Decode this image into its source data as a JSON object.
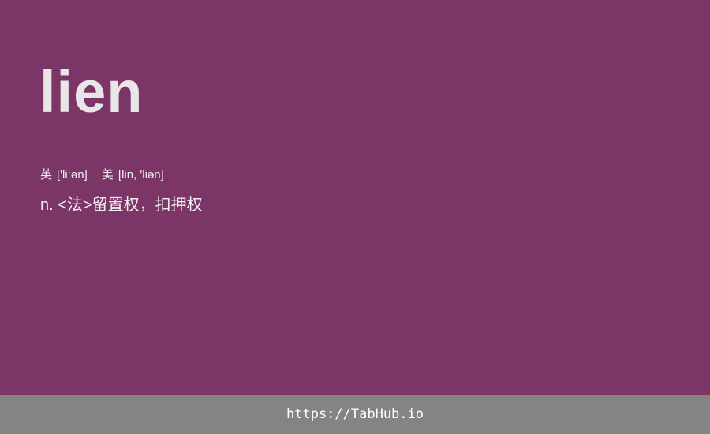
{
  "colors": {
    "background": "#7b3566",
    "footer_background": "#848484",
    "text": "#ececec"
  },
  "entry": {
    "word": "lien",
    "phonetics": {
      "uk_label": "英",
      "uk_ipa": "['liːən]",
      "us_label": "美",
      "us_ipa": "[lin, 'liən]"
    },
    "definition": "n. <法>留置权，扣押权"
  },
  "footer": {
    "url": "https://TabHub.io"
  }
}
